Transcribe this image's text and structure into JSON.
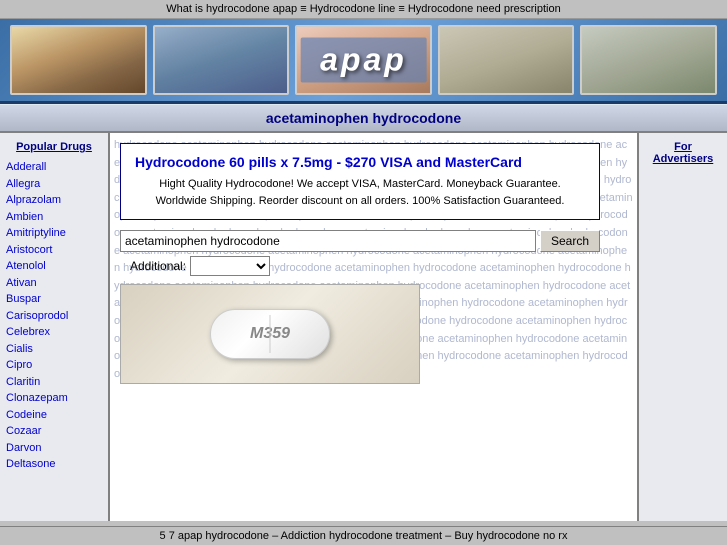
{
  "topbar": {
    "text": "What is hydrocodone apap ≡ Hydrocodone line ≡ Hydrocodone need prescription"
  },
  "header": {
    "logo_text": "apap"
  },
  "title": {
    "text": "acetaminophen hydrocodone"
  },
  "sidebar_left": {
    "heading": "Popular Drugs",
    "items": [
      "Adderall",
      "Allegra",
      "Alprazolam",
      "Ambien",
      "Amitriptyline",
      "Aristocort",
      "Atenolol",
      "Ativan",
      "Buspar",
      "Carisoprodol",
      "Celebrex",
      "Cialis",
      "Cipro",
      "Claritin",
      "Clonazepam",
      "Codeine",
      "Cozaar",
      "Darvon",
      "Deltasone"
    ]
  },
  "ad": {
    "title": "Hydrocodone 60 pills x 7.5mg - $270 VISA and MasterCard",
    "body": "Hight Quality Hydrocodone! We accept VISA, MasterCard. Moneyback Guarantee. Worldwide Shipping. Reorder discount on all orders. 100% Satisfaction Guaranteed."
  },
  "search": {
    "input_value": "acetaminophen hydrocodone",
    "input_placeholder": "acetaminophen hydrocodone",
    "button_label": "Search",
    "additional_label": "Additional:"
  },
  "pill": {
    "text": "M359"
  },
  "sidebar_right": {
    "heading": "For Advertisers"
  },
  "bottombar": {
    "text": "5 7 apap hydrocodone – Addiction hydrocodone treatment – Buy hydrocodone no rx"
  },
  "watermark": {
    "text": "hydrocodone acetaminophen hydrocodone acetaminophen hydrocodone acetaminophen hydrocodone acetaminophen hydrocodone acetaminophen hydrocodone acetaminophen hydrocodone acetaminophen hydrocodone acetaminophen hydrocodone acetaminophen hydrocodone "
  }
}
